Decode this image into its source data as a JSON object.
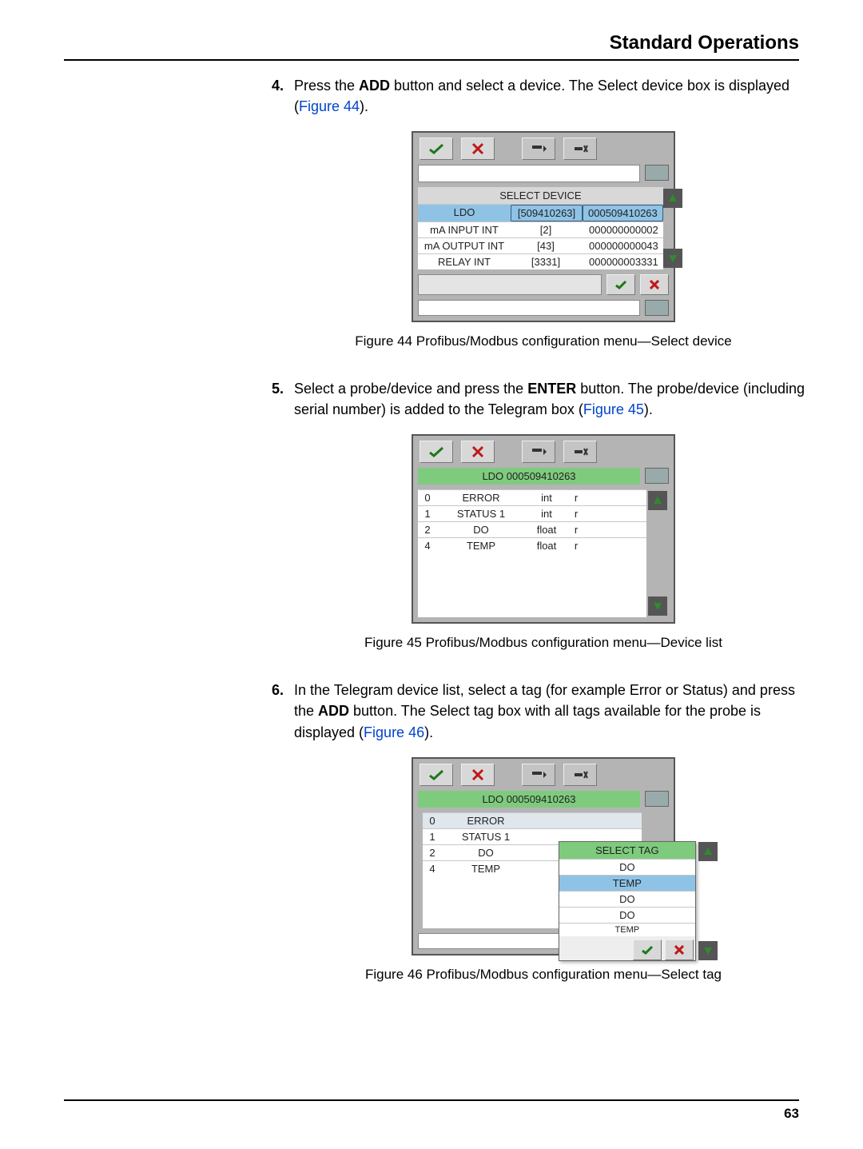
{
  "header": {
    "section_title": "Standard Operations"
  },
  "steps": {
    "s4": {
      "num": "4.",
      "pre": "Press the ",
      "add": "ADD",
      "mid": " button and select a device. The Select device box is displayed (",
      "link": "Figure 44",
      "post": ")."
    },
    "s5": {
      "num": "5.",
      "pre": "Select a probe/device and press the ",
      "enter": "ENTER",
      "mid": " button. The probe/device (including serial number) is added to the Telegram box (",
      "link": "Figure 45",
      "post": ")."
    },
    "s6": {
      "num": "6.",
      "pre": "In the Telegram device list, select a tag (for example Error or Status) and press the ",
      "add": "ADD",
      "mid": " button. The Select tag box with all tags available for the probe is displayed (",
      "link": "Figure 46",
      "post": ")."
    }
  },
  "captions": {
    "f44": "Figure 44  Profibus/Modbus configuration menu—Select device",
    "f45": "Figure 45  Profibus/Modbus configuration menu—Device list",
    "f46": "Figure 46  Profibus/Modbus configuration menu—Select tag"
  },
  "fig44": {
    "title": "SELECT DEVICE",
    "rows": [
      {
        "name": "LDO",
        "id": "[509410263]",
        "serial": "000509410263"
      },
      {
        "name": "mA INPUT INT",
        "id": "[2]",
        "serial": "000000000002"
      },
      {
        "name": "mA OUTPUT INT",
        "id": "[43]",
        "serial": "000000000043"
      },
      {
        "name": "RELAY INT",
        "id": "[3331]",
        "serial": "000000003331"
      }
    ]
  },
  "fig45": {
    "title": "LDO 000509410263",
    "rows": [
      {
        "idx": "0",
        "name": "ERROR",
        "type": "int",
        "mode": "r"
      },
      {
        "idx": "1",
        "name": "STATUS 1",
        "type": "int",
        "mode": "r"
      },
      {
        "idx": "2",
        "name": "DO",
        "type": "float",
        "mode": "r"
      },
      {
        "idx": "4",
        "name": "TEMP",
        "type": "float",
        "mode": "r"
      }
    ]
  },
  "fig46": {
    "title": "LDO 000509410263",
    "left_rows": [
      {
        "idx": "0",
        "name": "ERROR"
      },
      {
        "idx": "1",
        "name": "STATUS 1"
      },
      {
        "idx": "2",
        "name": "DO"
      },
      {
        "idx": "4",
        "name": "TEMP"
      }
    ],
    "popup_title": "SELECT TAG",
    "popup_rows": [
      "DO",
      "TEMP",
      "DO",
      "DO",
      "TEMP"
    ]
  },
  "page_number": "63"
}
